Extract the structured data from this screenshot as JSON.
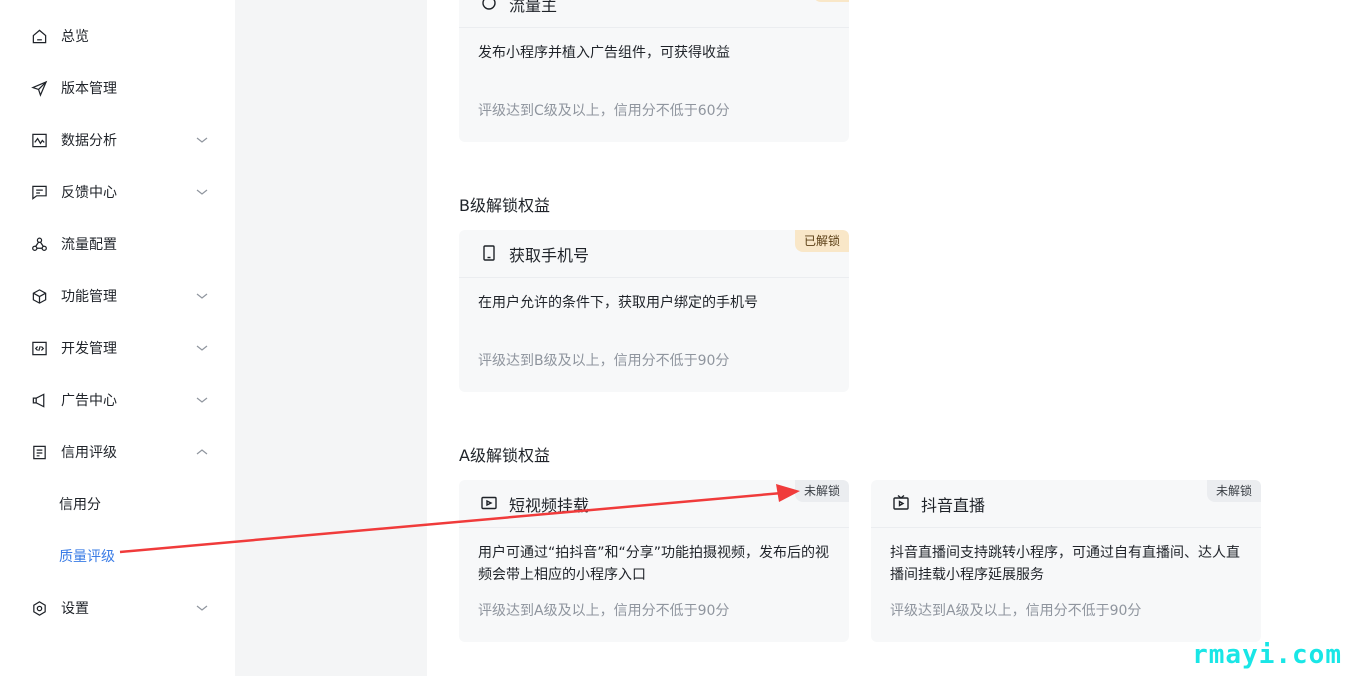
{
  "sidebar": {
    "items": [
      {
        "label": "总览",
        "icon": "home-icon"
      },
      {
        "label": "版本管理",
        "icon": "send-icon"
      },
      {
        "label": "数据分析",
        "icon": "chart-icon",
        "expandable": true
      },
      {
        "label": "反馈中心",
        "icon": "message-icon",
        "expandable": true
      },
      {
        "label": "流量配置",
        "icon": "share-nodes-icon"
      },
      {
        "label": "功能管理",
        "icon": "cube-icon",
        "expandable": true
      },
      {
        "label": "开发管理",
        "icon": "code-icon",
        "expandable": true
      },
      {
        "label": "广告中心",
        "icon": "megaphone-icon",
        "expandable": true
      },
      {
        "label": "信用评级",
        "icon": "document-icon",
        "expanded": true
      },
      {
        "label": "设置",
        "icon": "settings-icon",
        "expandable": true
      }
    ],
    "sub_items": [
      {
        "label": "信用分"
      },
      {
        "label": "质量评级",
        "active": true
      }
    ]
  },
  "sections": {
    "b": {
      "title": "B级解锁权益"
    },
    "a": {
      "title": "A级解锁权益"
    }
  },
  "cards": {
    "traffic": {
      "title": "流量主",
      "desc": "发布小程序并植入广告组件，可获得收益",
      "req": "评级达到C级及以上，信用分不低于60分"
    },
    "phone": {
      "title": "获取手机号",
      "badge": "已解锁",
      "desc": "在用户允许的条件下，获取用户绑定的手机号",
      "req": "评级达到B级及以上，信用分不低于90分"
    },
    "video": {
      "title": "短视频挂载",
      "badge": "未解锁",
      "desc": "用户可通过“拍抖音”和“分享”功能拍摄视频，发布后的视频会带上相应的小程序入口",
      "req": "评级达到A级及以上，信用分不低于90分"
    },
    "live": {
      "title": "抖音直播",
      "badge": "未解锁",
      "desc": "抖音直播间支持跳转小程序，可通过自有直播间、达人直播间挂载小程序延展服务",
      "req": "评级达到A级及以上，信用分不低于90分"
    }
  },
  "watermark": "rmayi.com",
  "colors": {
    "accent": "#3a7ce6",
    "arrow": "#f03b3b",
    "unlocked_badge": "#f9e7c8"
  }
}
